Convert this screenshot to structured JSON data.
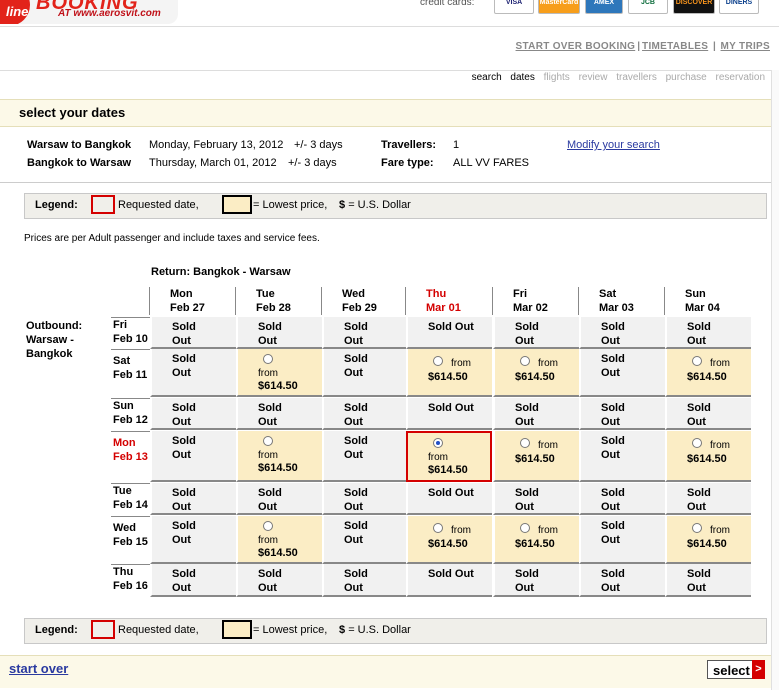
{
  "brand": {
    "badge": "line",
    "logo": "BOOKING",
    "url": "AT www.aerosvit.com"
  },
  "credit_cards": {
    "label": "credit cards:",
    "cards": [
      "VISA",
      "MasterCard",
      "AMEX",
      "JCB",
      "DISCOVER",
      "DINERS CLUB"
    ]
  },
  "top_links": [
    "START OVER BOOKING",
    "TIMETABLES",
    "MY TRIPS"
  ],
  "steps": {
    "items": [
      "search",
      "dates",
      "flights",
      "review",
      "travellers",
      "purchase",
      "reservation"
    ],
    "current": [
      "search",
      "dates"
    ]
  },
  "page_title": "select your dates",
  "trip": {
    "outbound_route": "Warsaw to Bangkok",
    "outbound_date": "Monday, February 13, 2012",
    "outbound_flex": "+/- 3 days",
    "return_route": "Bangkok to Warsaw",
    "return_date": "Thursday, March 01, 2012",
    "return_flex": "+/- 3 days",
    "travellers_label": "Travellers:",
    "travellers_value": "1",
    "fare_label": "Fare type:",
    "fare_value": "ALL VV FARES",
    "modify_link": "Modify your search"
  },
  "legend": {
    "label": "Legend:",
    "requested": "Requested date,",
    "lowest": "= Lowest price,",
    "currency_symbol": "$",
    "currency": "= U.S. Dollar"
  },
  "price_note": "Prices are per Adult passenger and include taxes and service fees.",
  "return_label": "Return: Bangkok - Warsaw",
  "outbound_label": [
    "Outbound:",
    "Warsaw -",
    "Bangkok"
  ],
  "columns": [
    {
      "dow": "Mon",
      "date": "Feb 27"
    },
    {
      "dow": "Tue",
      "date": "Feb 28"
    },
    {
      "dow": "Wed",
      "date": "Feb 29"
    },
    {
      "dow": "Thu",
      "date": "Mar 01",
      "highlight": true
    },
    {
      "dow": "Fri",
      "date": "Mar 02"
    },
    {
      "dow": "Sat",
      "date": "Mar 03"
    },
    {
      "dow": "Sun",
      "date": "Mar 04"
    }
  ],
  "rows": [
    {
      "dow": "Fri",
      "date": "Feb 10",
      "tall": false
    },
    {
      "dow": "Sat",
      "date": "Feb 11",
      "tall": true
    },
    {
      "dow": "Sun",
      "date": "Feb 12",
      "tall": false
    },
    {
      "dow": "Mon",
      "date": "Feb 13",
      "tall": true,
      "highlight": true
    },
    {
      "dow": "Tue",
      "date": "Feb 14",
      "tall": false
    },
    {
      "dow": "Wed",
      "date": "Feb 15",
      "tall": true
    },
    {
      "dow": "Thu",
      "date": "Feb 16",
      "tall": false
    }
  ],
  "grid": [
    [
      "S",
      "S",
      "S",
      "O",
      "S",
      "S",
      "S"
    ],
    [
      "S",
      "P",
      "S",
      "P",
      "P",
      "S",
      "P"
    ],
    [
      "S",
      "S",
      "S",
      "O",
      "S",
      "S",
      "S"
    ],
    [
      "S",
      "P",
      "S",
      "P*",
      "P",
      "S",
      "P"
    ],
    [
      "S",
      "S",
      "S",
      "O",
      "S",
      "S",
      "S"
    ],
    [
      "S",
      "P",
      "S",
      "P",
      "P",
      "S",
      "P"
    ],
    [
      "S",
      "S",
      "S",
      "O",
      "S",
      "S",
      "S"
    ]
  ],
  "cell_text": {
    "sold_line1": "Sold",
    "sold_line2": "Out",
    "sold_one_line": "Sold Out",
    "from": "from",
    "price": "$614.50"
  },
  "footer": {
    "start_over": "start over",
    "select": "select",
    "select_arrow": ">"
  },
  "colors": {
    "accent_red": "#d40000",
    "lowest_bg": "#fbedc5",
    "link_blue": "#2a3aa0"
  }
}
